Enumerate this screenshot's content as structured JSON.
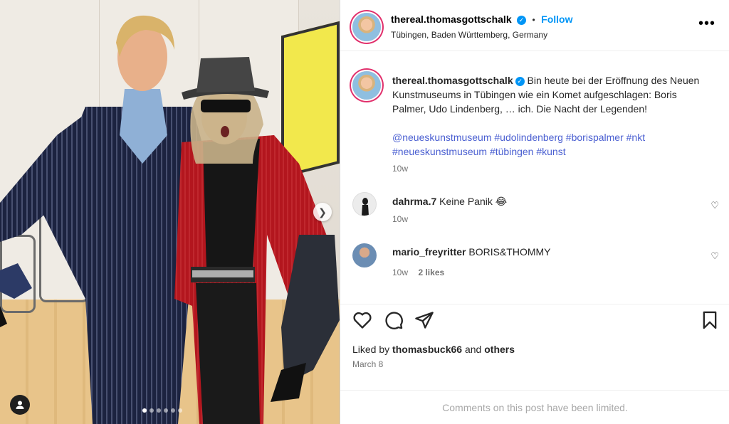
{
  "post": {
    "username": "thereal.thomasgottschalk",
    "follow_label": "Follow",
    "separator": "•",
    "location": "Tübingen, Baden Württemberg, Germany",
    "more_label": "•••"
  },
  "caption": {
    "username": "thereal.thomasgottschalk",
    "text": "Bin heute bei der Eröffnung des Neuen Kunstmuseums in Tübingen wie ein Komet aufgeschlagen: Boris Palmer, Udo Lindenberg, … ich. Die Nacht der Legenden!",
    "hashtags": "@neueskunstmuseum #udolindenberg #borispalmer #nkt #neueskunstmuseum #tübingen #kunst",
    "time": "10w"
  },
  "comments": [
    {
      "username": "dahrma.7",
      "text": "Keine Panik 😂",
      "time": "10w",
      "likes": ""
    },
    {
      "username": "mario_freyritter",
      "text": "BORIS&THOMMY",
      "time": "10w",
      "likes": "2 likes"
    }
  ],
  "likes": {
    "prefix": "Liked by",
    "user": "thomasbuck66",
    "conj": "and",
    "others": "others"
  },
  "date": "March 8",
  "comments_limited": "Comments on this post have been limited.",
  "colors": {
    "link": "#0095f6",
    "hashtag": "#4a5fd1",
    "meta": "#737373"
  },
  "carousel": {
    "slide_count": 6,
    "active_index": 0
  }
}
